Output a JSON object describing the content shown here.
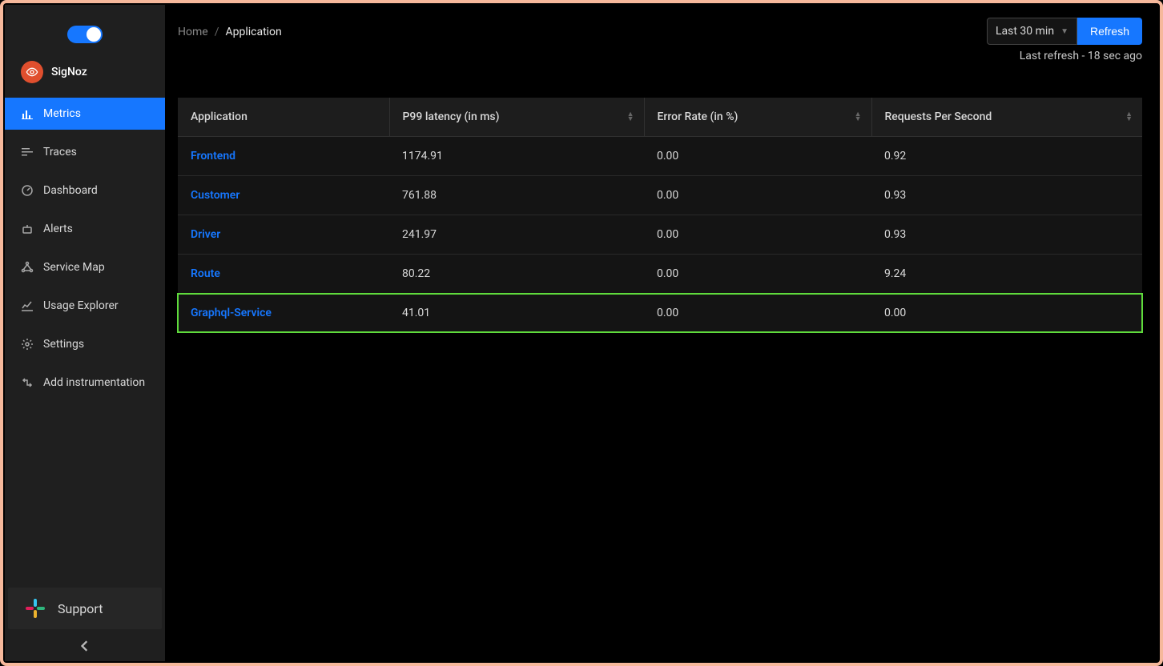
{
  "brand": {
    "name": "SigNoz"
  },
  "sidebar": {
    "items": [
      {
        "label": "Metrics",
        "active": true
      },
      {
        "label": "Traces"
      },
      {
        "label": "Dashboard"
      },
      {
        "label": "Alerts"
      },
      {
        "label": "Service Map"
      },
      {
        "label": "Usage Explorer"
      },
      {
        "label": "Settings"
      },
      {
        "label": "Add instrumentation"
      }
    ],
    "support_label": "Support"
  },
  "breadcrumb": {
    "home": "Home",
    "current": "Application"
  },
  "toolbar": {
    "timerange_label": "Last 30 min",
    "refresh_label": "Refresh",
    "last_refresh": "Last refresh - 18 sec ago"
  },
  "table": {
    "columns": {
      "application": "Application",
      "p99": "P99 latency (in ms)",
      "error_rate": "Error Rate (in %)",
      "rps": "Requests Per Second"
    },
    "rows": [
      {
        "app": "Frontend",
        "p99": "1174.91",
        "err": "0.00",
        "rps": "0.92",
        "highlight": false
      },
      {
        "app": "Customer",
        "p99": "761.88",
        "err": "0.00",
        "rps": "0.93",
        "highlight": false
      },
      {
        "app": "Driver",
        "p99": "241.97",
        "err": "0.00",
        "rps": "0.93",
        "highlight": false
      },
      {
        "app": "Route",
        "p99": "80.22",
        "err": "0.00",
        "rps": "9.24",
        "highlight": false
      },
      {
        "app": "Graphql-Service",
        "p99": "41.01",
        "err": "0.00",
        "rps": "0.00",
        "highlight": true
      }
    ]
  }
}
